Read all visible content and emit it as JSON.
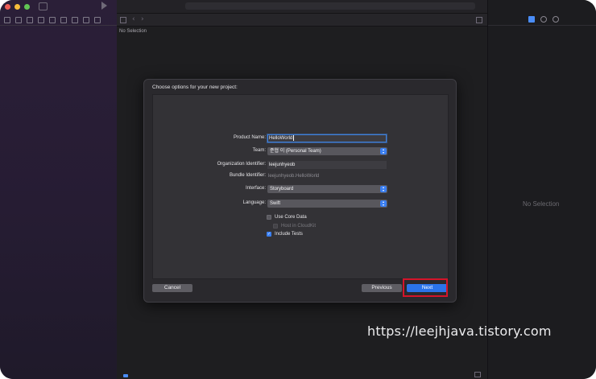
{
  "status_text": "No Selection",
  "dialog": {
    "title": "Choose options for your new project:",
    "fields": {
      "product_name": {
        "label": "Product Name:",
        "value": "HelloWorld"
      },
      "team": {
        "label": "Team:",
        "value": "준협 이 (Personal Team)"
      },
      "organization_identifier": {
        "label": "Organization Identifier:",
        "value": "leejunhyeob"
      },
      "bundle_identifier": {
        "label": "Bundle Identifier:",
        "value": "leejunhyeob.HelloWorld"
      },
      "interface": {
        "label": "Interface:",
        "value": "Storyboard"
      },
      "language": {
        "label": "Language:",
        "value": "Swift"
      }
    },
    "checkboxes": {
      "use_core_data": {
        "label": "Use Core Data",
        "checked": false
      },
      "host_in_cloudkit": {
        "label": "Host in CloudKit",
        "checked": false,
        "disabled": true
      },
      "include_tests": {
        "label": "Include Tests",
        "checked": true
      }
    },
    "buttons": {
      "cancel": "Cancel",
      "previous": "Previous",
      "next": "Next"
    }
  },
  "watermark": "https://leejhjava.tistory.com",
  "colors": {
    "accent": "#2b73ea",
    "highlight": "#d4142a"
  }
}
